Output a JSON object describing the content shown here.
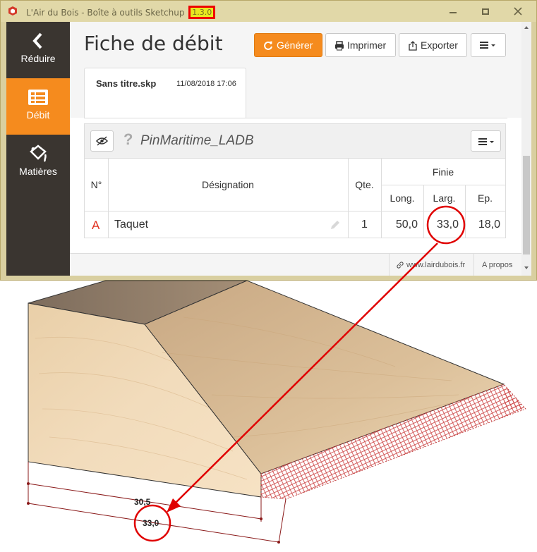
{
  "window": {
    "title": "L'Air du Bois - Boîte à outils Sketchup",
    "version": "1.3.0",
    "highlight_color": "#e00000"
  },
  "sidebar": {
    "items": [
      {
        "label": "Réduire",
        "icon": "chevron-left-icon"
      },
      {
        "label": "Débit",
        "icon": "cutlist-icon",
        "active": true
      },
      {
        "label": "Matières",
        "icon": "paint-bucket-icon"
      }
    ]
  },
  "header": {
    "title": "Fiche de débit",
    "buttons": {
      "generate": "Générer",
      "print": "Imprimer",
      "export": "Exporter"
    }
  },
  "tab": {
    "name": "Sans titre.skp",
    "date": "11/08/2018 17:06"
  },
  "group": {
    "material": "PinMaritime_LADB",
    "question": "?"
  },
  "table": {
    "headers": {
      "number": "N°",
      "designation": "Désignation",
      "quantity": "Qte.",
      "finish": "Finie",
      "length": "Long.",
      "width": "Larg.",
      "thickness": "Ep."
    },
    "rows": [
      {
        "number": "A",
        "designation": "Taquet",
        "quantity": "1",
        "length": "50,0",
        "width": "33,0",
        "thickness": "18,0"
      }
    ]
  },
  "footer": {
    "website": "www.lairdubois.fr",
    "about": "A propos"
  },
  "drawing": {
    "dimension_inner": "30,5",
    "dimension_outer": "33,0"
  },
  "colors": {
    "accent": "#f58b1e",
    "sidebar": "#3a3530",
    "titlebar": "#e1d8a8",
    "annotation": "#e00000"
  }
}
